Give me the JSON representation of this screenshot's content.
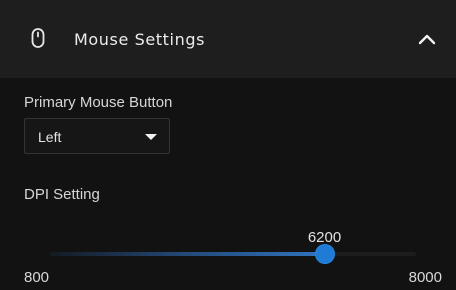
{
  "header": {
    "icon": "mouse-icon",
    "title": "Mouse Settings",
    "collapse_icon": "chevron-up-icon"
  },
  "primary_button": {
    "label": "Primary Mouse Button",
    "selected": "Left"
  },
  "dpi": {
    "label": "DPI Setting",
    "min": 800,
    "max": 8000,
    "value": 6200,
    "min_label": "800",
    "max_label": "8000",
    "value_label": "6200"
  },
  "colors": {
    "accent": "#1f7bd6",
    "header_background": "#1e1e1e",
    "panel_background": "#121212"
  }
}
